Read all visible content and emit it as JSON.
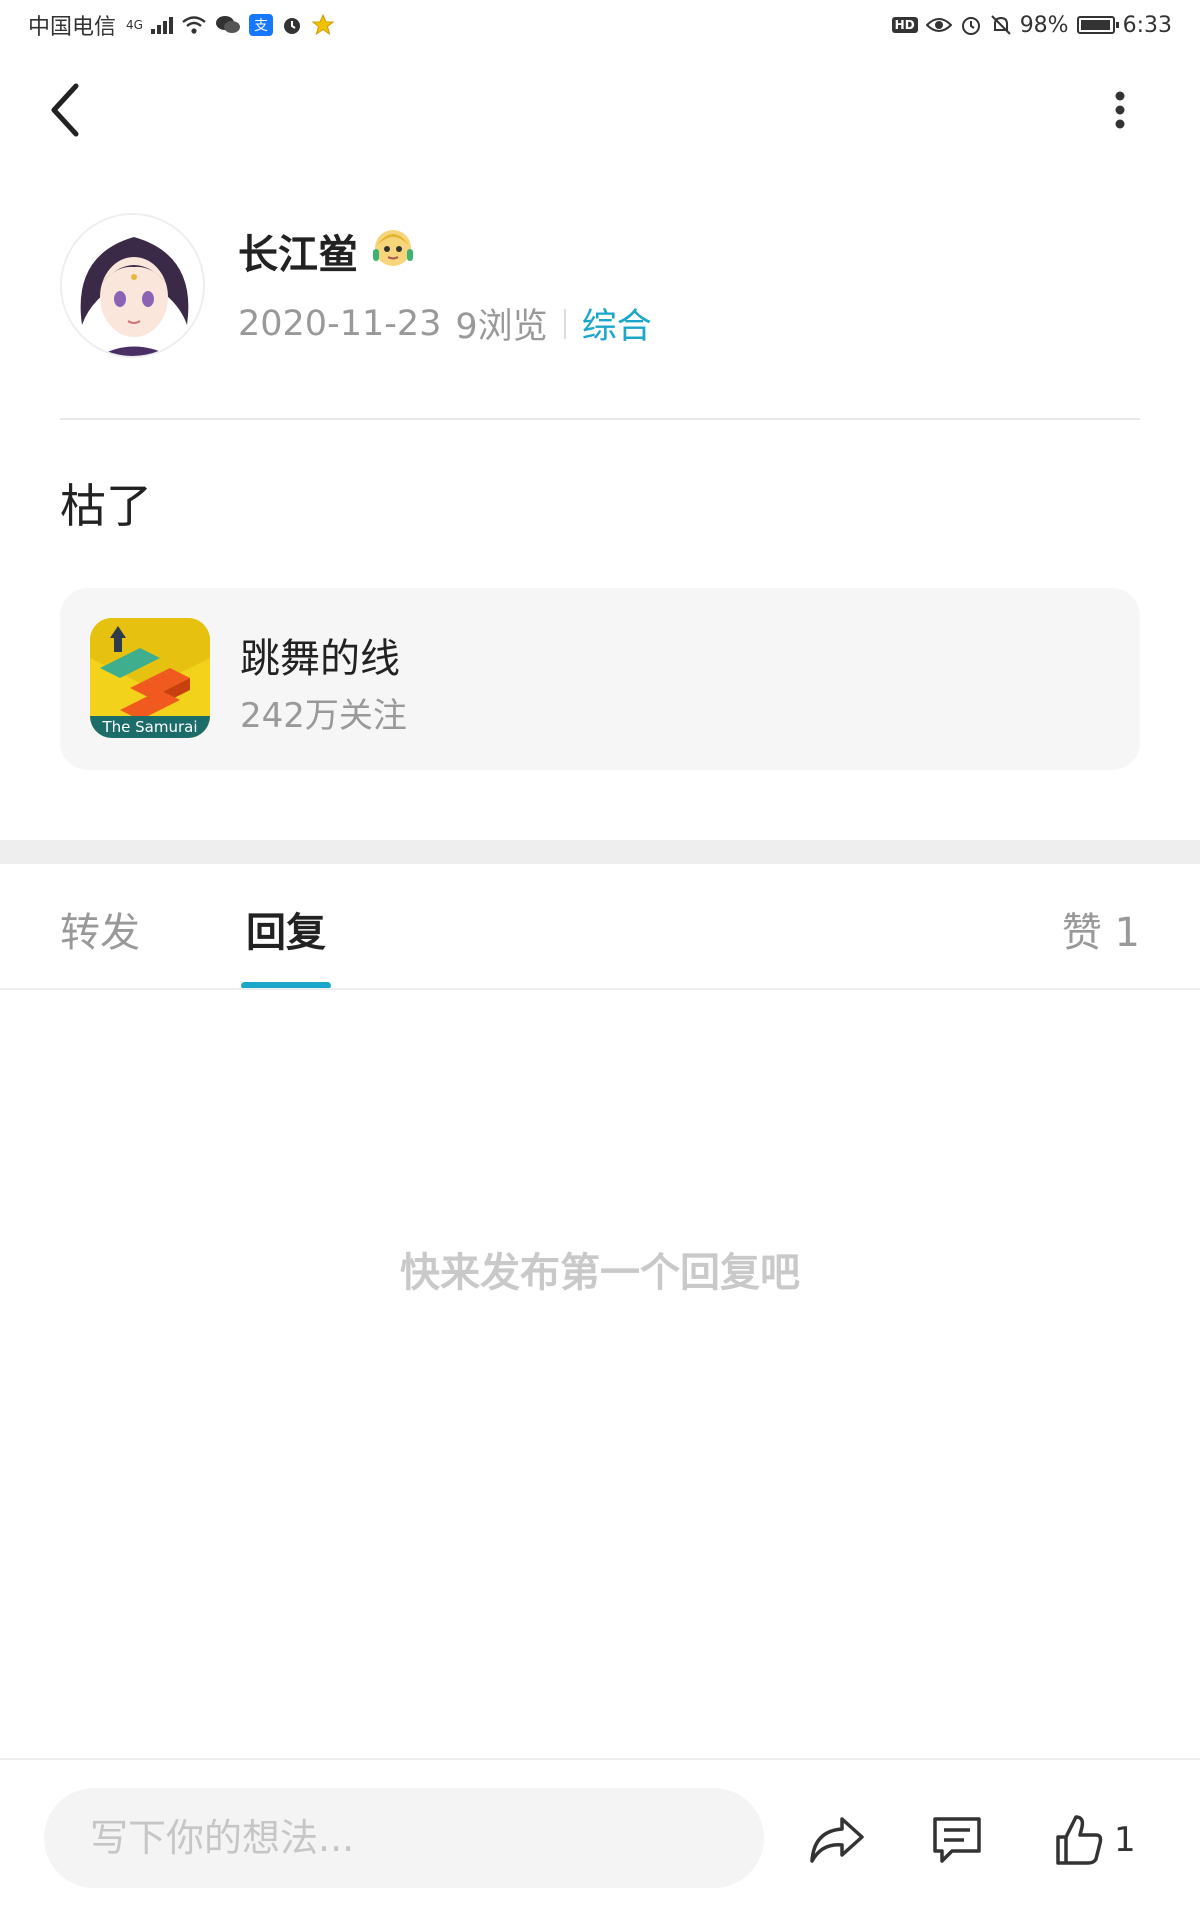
{
  "status_bar": {
    "carrier": "中国电信",
    "network": "4G",
    "battery_percent": "98%",
    "battery_level": 0.98,
    "time": "6:33",
    "hd_label": "HD",
    "icons": [
      "signal-icon",
      "wifi-icon",
      "wechat-icon",
      "alipay-icon",
      "alarm-icon",
      "star-app-icon",
      "eye-icon",
      "alarm-clock-icon",
      "mute-icon",
      "battery-icon"
    ]
  },
  "nav": {
    "back_icon": "chevron-left-icon",
    "more_icon": "more-vertical-icon"
  },
  "post": {
    "author_name": "长江鲎",
    "date": "2020-11-23",
    "views": "9浏览",
    "category": "综合",
    "content": "枯了"
  },
  "game": {
    "name": "跳舞的线",
    "followers": "242万关注",
    "icon_caption": "The Samurai"
  },
  "tabs": {
    "forward": "转发",
    "reply": "回复",
    "like": "赞 1",
    "active": "reply"
  },
  "empty_state": "快来发布第一个回复吧",
  "bottom_bar": {
    "input_placeholder": "写下你的想法...",
    "like_count": "1"
  },
  "colors": {
    "accent": "#1aa7c9",
    "muted_text": "#999999",
    "card_bg": "#f6f6f6"
  }
}
